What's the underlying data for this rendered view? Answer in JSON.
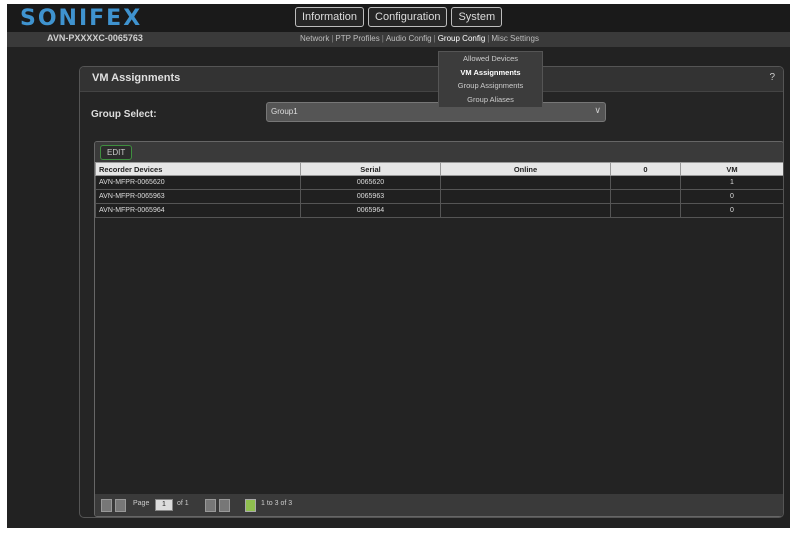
{
  "app": {
    "logo": "SONIFEX",
    "device_name": "AVN-PXXXXC-0065763"
  },
  "topnav": [
    "Information",
    "Configuration",
    "System"
  ],
  "subnav": {
    "items": [
      "Network",
      "PTP Profiles",
      "Audio Config",
      "Group Config",
      "Misc Settings"
    ],
    "active_index": 3,
    "separator": "|"
  },
  "dropdown": {
    "items": [
      "Allowed Devices",
      "VM Assignments",
      "Group Assignments",
      "Group Aliases"
    ],
    "active_index": 1
  },
  "panel": {
    "title": "VM Assignments",
    "help": "?"
  },
  "group_select": {
    "label": "Group Select:",
    "value": "Group1",
    "chevron": "∨"
  },
  "table": {
    "edit_label": "EDIT",
    "headers": [
      "Recorder Devices",
      "Serial",
      "Online",
      "0",
      "VM"
    ],
    "rows": [
      [
        "AVN-MFPR-0065620",
        "0065620",
        "",
        "",
        "1"
      ],
      [
        "AVN-MFPR-0065963",
        "0065963",
        "",
        "",
        "0"
      ],
      [
        "AVN-MFPR-0065964",
        "0065964",
        "",
        "",
        "0"
      ]
    ]
  },
  "pager": {
    "page_label": "Page",
    "page_value": "1",
    "of_label": "of 1",
    "count_label": "1 to 3 of 3"
  },
  "colors": {
    "logo": "#3f93cf",
    "background": "#222222",
    "header_row": "#e6e6e6",
    "refresh": "#8fbf4f"
  }
}
